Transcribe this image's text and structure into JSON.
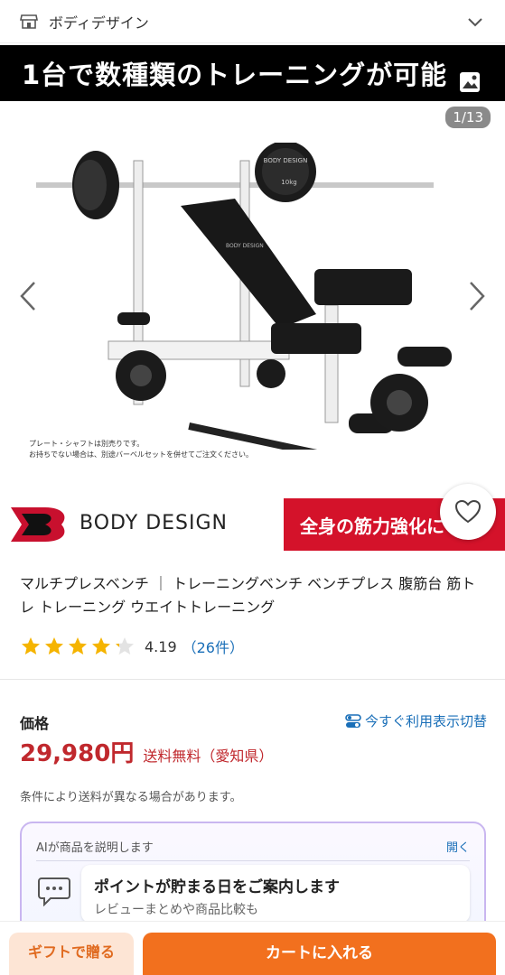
{
  "store": {
    "name": "ボディデザイン"
  },
  "carousel": {
    "banner": "1台で数種類のトレーニングが可能",
    "counter": "1/13",
    "caption_line1": "プレート・シャフトは別売りです。",
    "caption_line2": "お持ちでない場合は、別途バーベルセットを併せてご注文ください。",
    "brand_text": "BODY DESIGN",
    "red_banner": "全身の筋力強化に",
    "plate_label": "BODY DESIGN",
    "plate_weight": "10kg",
    "bench_logo_text": "BODY DESIGN"
  },
  "product": {
    "title": "マルチプレスベンチ ｜ トレーニングベンチ ベンチプレス 腹筋台 筋トレ トレーニング ウエイトトレーニング",
    "rating": 4.19,
    "rating_text": "4.19",
    "review_count": "（26件）"
  },
  "price": {
    "label": "価格",
    "value": "29,980円",
    "shipping": "送料無料（愛知県）",
    "toggle_label": "今すぐ利用表示切替",
    "note": "条件により送料が異なる場合があります。"
  },
  "ai": {
    "header": "AIが商品を説明します",
    "open": "開く",
    "main": "ポイントが貯まる日をご案内します",
    "sub": "レビューまとめや商品比較も"
  },
  "actions": {
    "gift": "ギフトで贈る",
    "cart": "カートに入れる"
  },
  "colors": {
    "accent": "#f2701e",
    "price": "#c0282d",
    "link": "#1a6fb8",
    "star": "#f5b400",
    "brand_red": "#d4122a"
  },
  "icons": [
    "store-icon",
    "chevron-down-icon",
    "image-icon",
    "chevron-left-icon",
    "chevron-right-icon",
    "heart-icon",
    "star-icon",
    "toggle-icon",
    "chat-bubble-icon"
  ]
}
